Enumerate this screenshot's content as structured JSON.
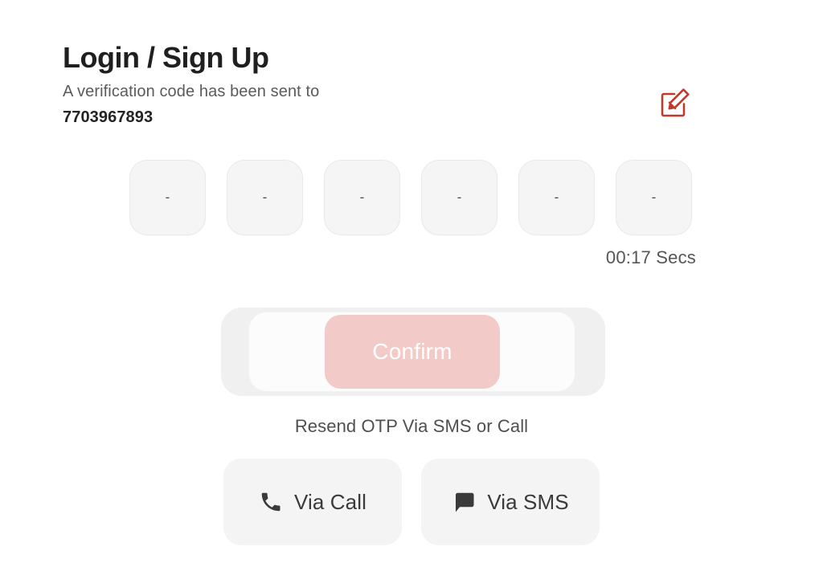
{
  "page": {
    "title": "Login / Sign Up",
    "background_color": "#ffffff"
  },
  "verification": {
    "message": "A verification code has been sent to",
    "phone_number": "7703967893",
    "edit_icon": "edit-pencil-square-icon",
    "edit_icon_color": "#bf3a2e"
  },
  "otp": {
    "length": 6,
    "boxes": [
      {
        "value": "-"
      },
      {
        "value": "-"
      },
      {
        "value": "-"
      },
      {
        "value": "-"
      },
      {
        "value": "-"
      },
      {
        "value": "-"
      }
    ],
    "box_fill_color": "#f5f5f5",
    "box_border_color": "#e9e9e9"
  },
  "timer": {
    "text": "00:17 Secs"
  },
  "confirm": {
    "label": "Confirm",
    "state": "disabled",
    "button_color": "#f2cbc8",
    "label_color": "#ffffff",
    "inner_panel_color": "#fcfcfc",
    "outer_panel_color": "#f0f0f0"
  },
  "resend": {
    "label": "Resend OTP Via SMS or Call",
    "options": [
      {
        "label": "Via Call",
        "icon": "phone-icon"
      },
      {
        "label": "Via SMS",
        "icon": "chat-bubble-icon"
      }
    ],
    "button_color": "#f4f4f4",
    "text_color": "#3a3a3a"
  }
}
